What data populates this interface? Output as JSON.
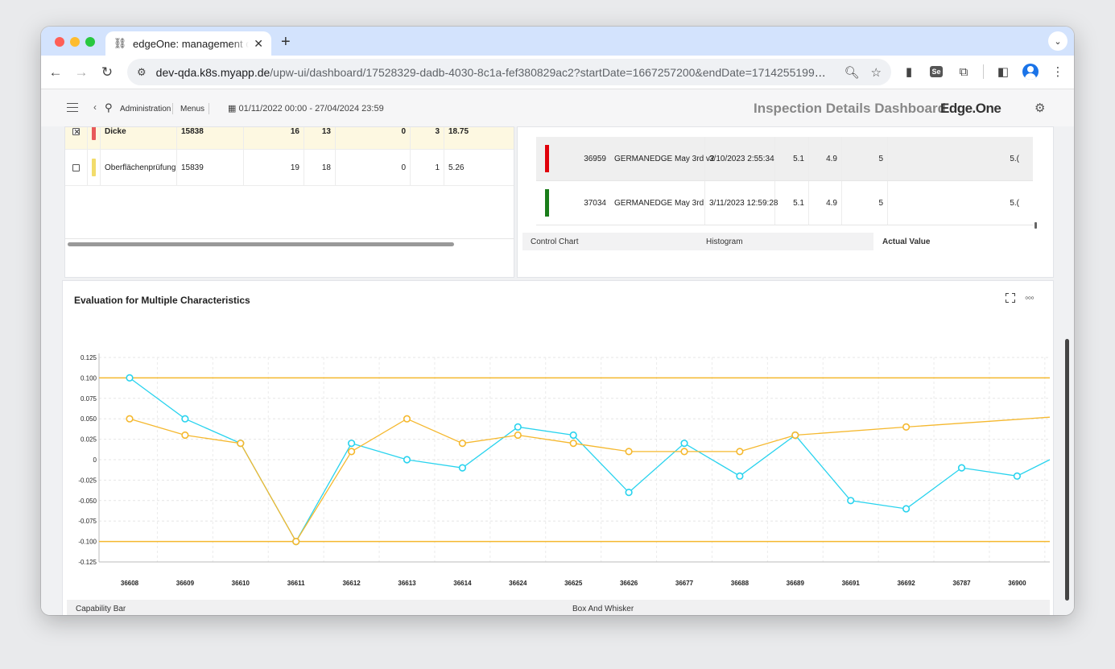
{
  "browser": {
    "tab_title": "edgeOne: management of ma",
    "url_host": "dev-qda.k8s.myapp.de",
    "url_path": "/upw-ui/dashboard/17528329-dadb-4030-8c1a-fef380829ac2?startDate=1667257200&endDate=1714255199&qarPart=..."
  },
  "header": {
    "breadcrumb_admin": "Administration",
    "breadcrumb_menus": "Menus",
    "date_range": "01/11/2022 00:00 - 27/04/2024 23:59",
    "dashboard_title": "Inspection Details Dashboard",
    "brand": "Edge.One"
  },
  "characteristics_table": {
    "rows": [
      {
        "checked": true,
        "flag_color": "#e85a5a",
        "name": "Dicke",
        "id": "15838",
        "c1": "16",
        "c2": "13",
        "c3": "0",
        "c4": "3",
        "c5": "18.75"
      },
      {
        "checked": false,
        "flag_color": "#f2dc6b",
        "name": "Oberflächenprüfung",
        "id": "15839",
        "c1": "19",
        "c2": "18",
        "c3": "0",
        "c4": "1",
        "c5": "5.26"
      }
    ]
  },
  "values_table": {
    "rows": [
      {
        "flag_color": "#e0000a",
        "id": "36959",
        "name": "GERMANEDGE May 3rd v2",
        "date": "3/10/2023 2:55:34",
        "v1": "5.1",
        "v2": "4.9",
        "v3": "5",
        "v4": "5.("
      },
      {
        "flag_color": "#1a7d1a",
        "id": "37034",
        "name": "GERMANEDGE May 3rd",
        "date": "3/11/2023 12:59:28",
        "v1": "5.1",
        "v2": "4.9",
        "v3": "5",
        "v4": "5.("
      }
    ],
    "tabs": [
      "Control Chart",
      "Histogram",
      "Actual Value"
    ]
  },
  "chart_card": {
    "title": "Evaluation for Multiple Characteristics",
    "tabs": [
      "Capability Bar",
      "Box And Whisker"
    ]
  },
  "chart_data": {
    "type": "line",
    "title": "Evaluation for Multiple Characteristics",
    "categories": [
      "36608",
      "36609",
      "36610",
      "36611",
      "36612",
      "36613",
      "36614",
      "36624",
      "36625",
      "36626",
      "36677",
      "36688",
      "36689",
      "36691",
      "36692",
      "36787",
      "36900"
    ],
    "y_ticks": [
      0.125,
      0.1,
      0.075,
      0.05,
      0.025,
      0,
      -0.025,
      -0.05,
      -0.075,
      -0.1,
      -0.125
    ],
    "y_tick_labels": [
      "0.125",
      "0.100",
      "0.075",
      "0.050",
      "0.025",
      "0",
      "-0.025",
      "-0.050",
      "-0.075",
      "-0.100",
      "-0.125"
    ],
    "ylim": [
      -0.125,
      0.125
    ],
    "limit_lines": [
      0.1,
      -0.1
    ],
    "limit_color": "#f5b82e",
    "grid": true,
    "series": [
      {
        "color": "#29d3ee",
        "values": [
          0.1,
          0.05,
          0.02,
          -0.1,
          0.02,
          0.0,
          -0.01,
          0.04,
          0.03,
          -0.04,
          0.02,
          -0.02,
          0.03,
          -0.05,
          -0.06,
          -0.01,
          -0.02
        ],
        "end_value": 0.0
      },
      {
        "color": "#f5b82e",
        "values": [
          0.05,
          0.03,
          0.02,
          -0.1,
          0.01,
          0.05,
          0.02,
          0.03,
          0.02,
          0.01,
          0.01,
          0.01,
          0.03,
          null,
          0.04,
          null,
          null
        ],
        "end_value": 0.052
      }
    ]
  }
}
